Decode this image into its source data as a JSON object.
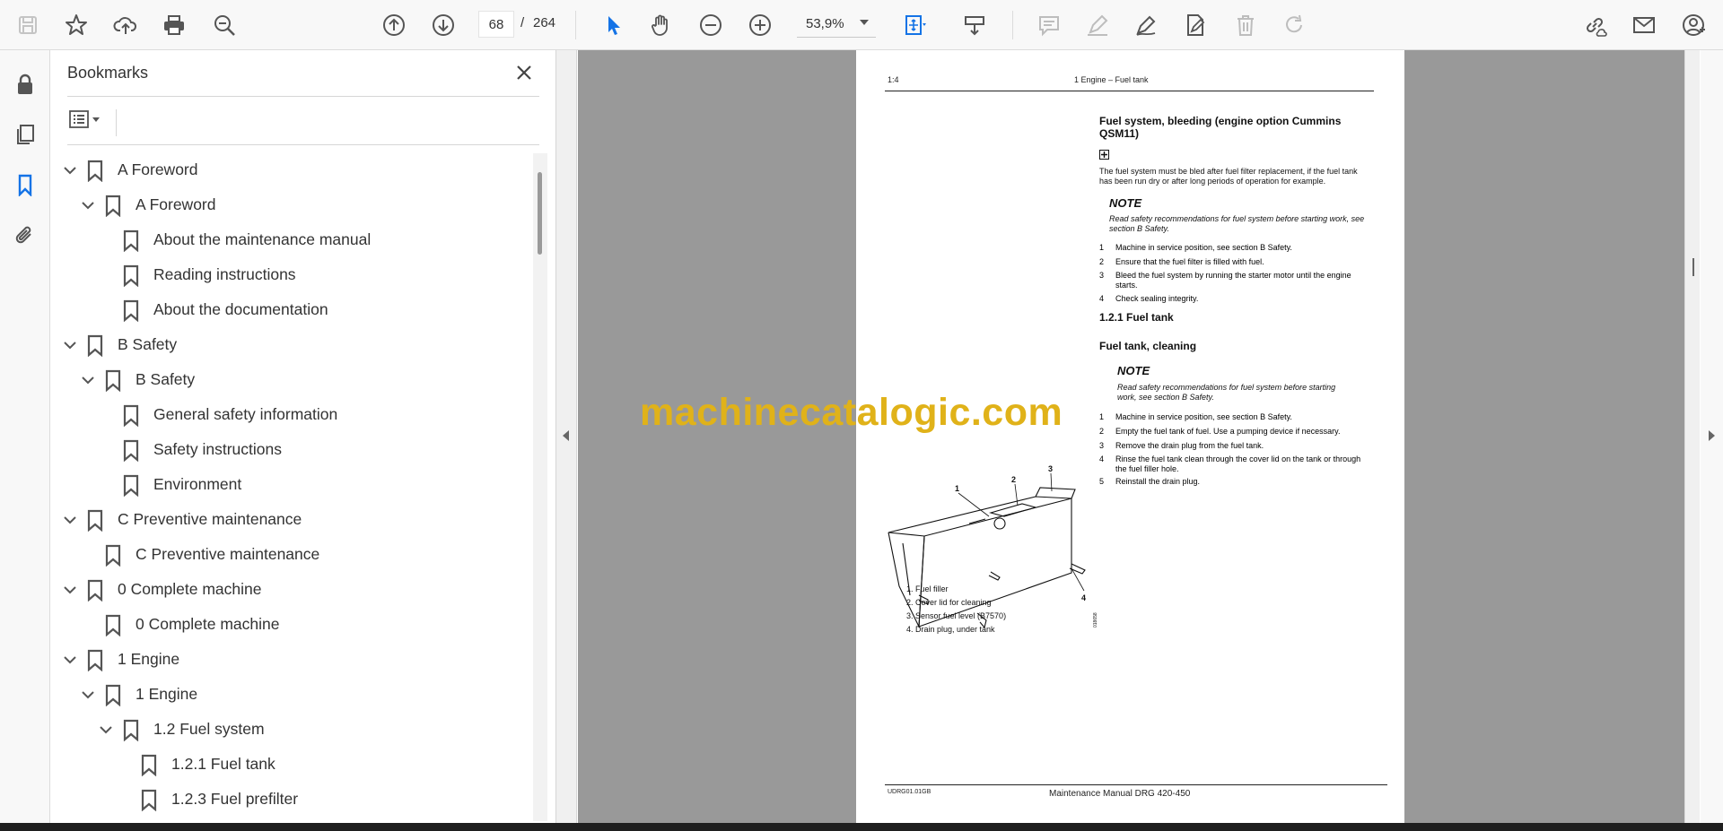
{
  "toolbar": {
    "page_current": "68",
    "page_sep": "/",
    "page_total": "264",
    "zoom": "53,9%"
  },
  "bookmarks": {
    "title": "Bookmarks",
    "items": [
      {
        "label": "A Foreword"
      },
      {
        "label": "A Foreword"
      },
      {
        "label": "About the maintenance manual"
      },
      {
        "label": "Reading instructions"
      },
      {
        "label": "About the documentation"
      },
      {
        "label": "B Safety"
      },
      {
        "label": "B Safety"
      },
      {
        "label": "General safety information"
      },
      {
        "label": "Safety instructions"
      },
      {
        "label": "Environment"
      },
      {
        "label": "C Preventive maintenance"
      },
      {
        "label": "C Preventive maintenance"
      },
      {
        "label": "0 Complete machine"
      },
      {
        "label": "0 Complete machine"
      },
      {
        "label": "1 Engine"
      },
      {
        "label": "1 Engine"
      },
      {
        "label": "1.2 Fuel system"
      },
      {
        "label": "1.2.1 Fuel tank"
      },
      {
        "label": "1.2.3 Fuel prefilter"
      }
    ]
  },
  "pdf": {
    "header_left": "1:4",
    "header_right": "1 Engine – Fuel tank",
    "section1_title": "Fuel system, bleeding (engine option Cummins QSM11)",
    "section1_body": "The fuel system must be bled after fuel filter replacement, if the fuel tank has been run dry or after long periods of operation for example.",
    "note_label": "NOTE",
    "note1_text": "Read safety recommendations for fuel system before starting work, see section B Safety.",
    "steps1": [
      {
        "n": "1",
        "t": "Machine in service position, see section B Safety."
      },
      {
        "n": "2",
        "t": "Ensure that the fuel filter is filled with fuel."
      },
      {
        "n": "3",
        "t": "Bleed the fuel system by running the starter motor until the engine starts."
      },
      {
        "n": "4",
        "t": "Check sealing integrity."
      }
    ],
    "subsection": "1.2.1 Fuel tank",
    "section2_title": "Fuel tank, cleaning",
    "note2_label": "NOTE",
    "note2_text": "Read safety recommendations for fuel system before starting work, see section B Safety.",
    "steps2": [
      {
        "n": "1",
        "t": "Machine in service position, see section B Safety."
      },
      {
        "n": "2",
        "t": "Empty the fuel tank of fuel. Use a pumping device if necessary."
      },
      {
        "n": "3",
        "t": "Remove the drain plug from the fuel tank."
      },
      {
        "n": "4",
        "t": "Rinse the fuel tank clean through the cover lid on the tank or through the fuel filler hole."
      },
      {
        "n": "5",
        "t": "Reinstall the drain plug."
      }
    ],
    "figure_callouts": [
      "1",
      "2",
      "3",
      "4"
    ],
    "figure_id": "018658",
    "captions": [
      "1.  Fuel filler",
      "2.  Cover lid for cleaning",
      "3.  Sensor fuel level (B7570)",
      "4.  Drain plug, under tank"
    ],
    "footer_left": "UDRG01.01GB",
    "footer_right": "Maintenance Manual DRG 420-450"
  },
  "watermark": "machinecatalogic.com"
}
